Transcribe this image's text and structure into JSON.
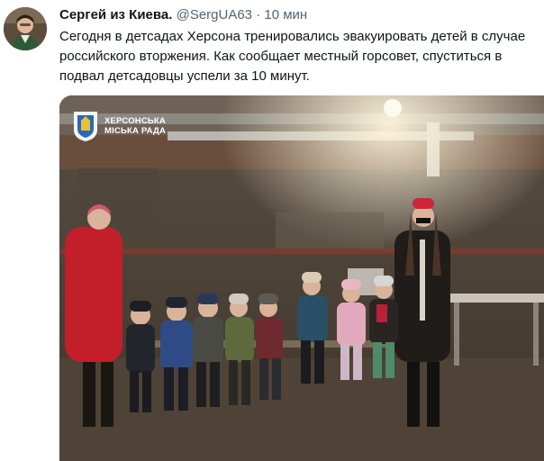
{
  "tweet": {
    "author_name": "Сергей из Киева.",
    "handle": "@SergUA63",
    "separator": "·",
    "time": "10 мин",
    "text": "Сегодня в детсадах Херсона тренировались эвакуировать детей в случае российского вторжения. Как сообщает местный горсовет, спуститься в подвал детсадовцы успели за 10 минут."
  },
  "media": {
    "logo_line1": "ХЕРСОНСЬКА",
    "logo_line2": "МІСЬКА РАДА",
    "colors": {
      "wall": "#4a4036",
      "floor": "#574a3c",
      "red_coat": "#c21f2a",
      "crest_bg": "#f2f4f6",
      "crest_blue": "#2c66b8",
      "crest_yellow": "#e5c23a"
    }
  }
}
